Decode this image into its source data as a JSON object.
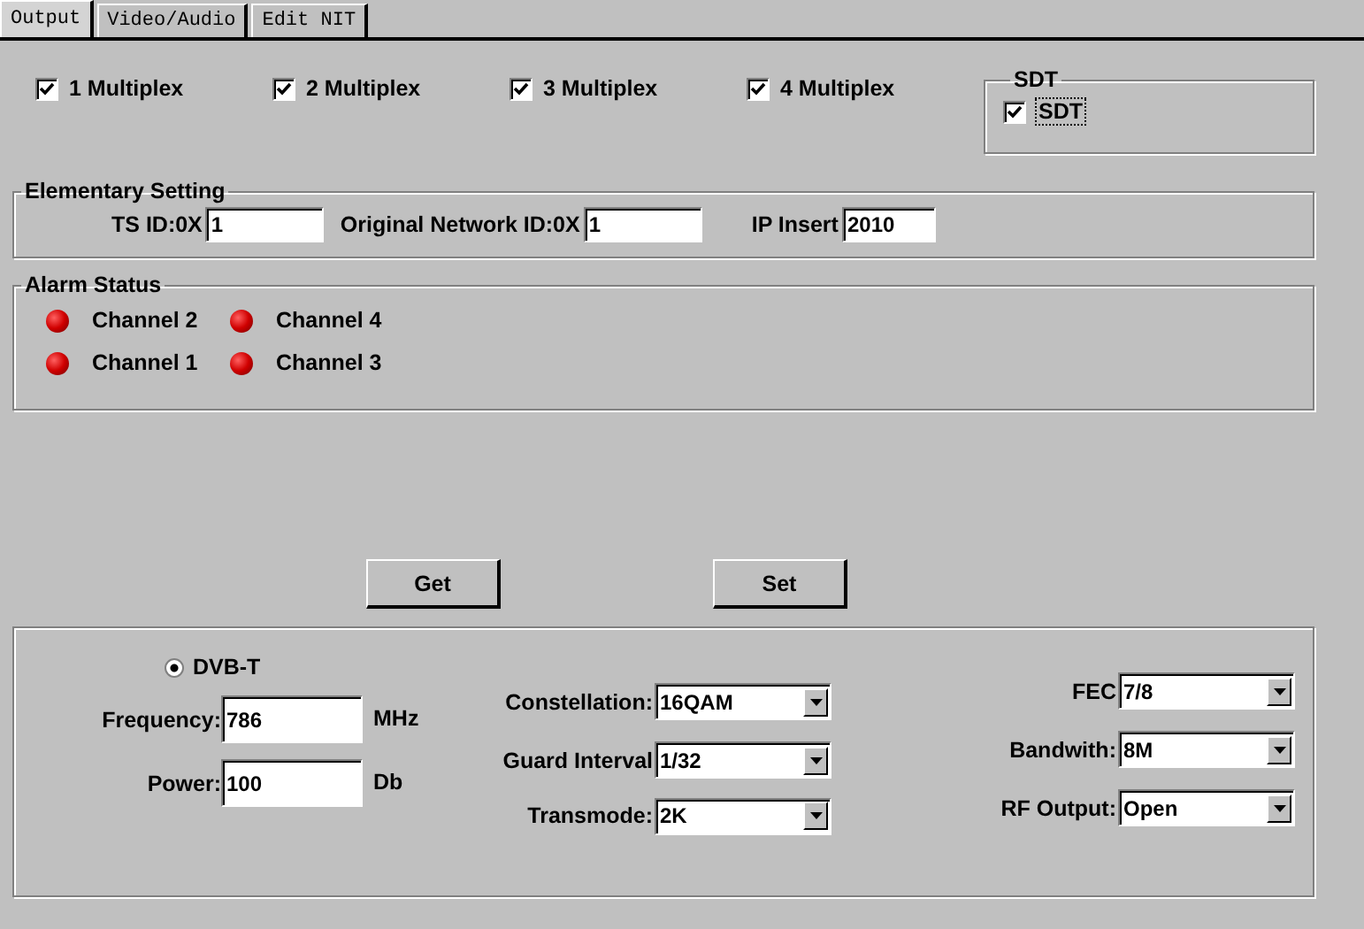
{
  "tabs": [
    {
      "label": "Output",
      "selected": true
    },
    {
      "label": "Video/Audio",
      "selected": false
    },
    {
      "label": "Edit NIT",
      "selected": false
    }
  ],
  "multiplex": [
    {
      "label": "1 Multiplex",
      "checked": true
    },
    {
      "label": "2 Multiplex",
      "checked": true
    },
    {
      "label": "3 Multiplex",
      "checked": true
    },
    {
      "label": "4 Multiplex",
      "checked": true
    }
  ],
  "sdt": {
    "title": "SDT",
    "label": "SDT",
    "checked": true
  },
  "elementary_setting": {
    "title": "Elementary Setting",
    "fields": [
      {
        "label": "TS ID:0X",
        "value": "1"
      },
      {
        "label": "Original Network ID:0X",
        "value": "1"
      },
      {
        "label": "IP Insert",
        "value": "2010"
      }
    ]
  },
  "alarm_status": {
    "title": "Alarm Status",
    "channels": [
      {
        "label": "Channel 2"
      },
      {
        "label": "Channel 4"
      },
      {
        "label": "Channel 1"
      },
      {
        "label": "Channel 3"
      }
    ]
  },
  "buttons": [
    "Get",
    "Set"
  ],
  "modulation": {
    "mode": {
      "label": "DVB-T",
      "selected": true
    },
    "fields": [
      {
        "label": "Frequency:",
        "value": "786",
        "unit": "MHz"
      },
      {
        "label": "Power:",
        "value": "100",
        "unit": "Db"
      }
    ],
    "settings_center": [
      {
        "label": "Constellation:",
        "value": "16QAM"
      },
      {
        "label": "Guard Interval",
        "value": "1/32"
      },
      {
        "label": "Transmode:",
        "value": "2K"
      }
    ],
    "settings_right": [
      {
        "label": "FEC",
        "value": "7/8"
      },
      {
        "label": "Bandwith:",
        "value": "8M"
      },
      {
        "label": "RF Output:",
        "value": "Open"
      }
    ]
  }
}
